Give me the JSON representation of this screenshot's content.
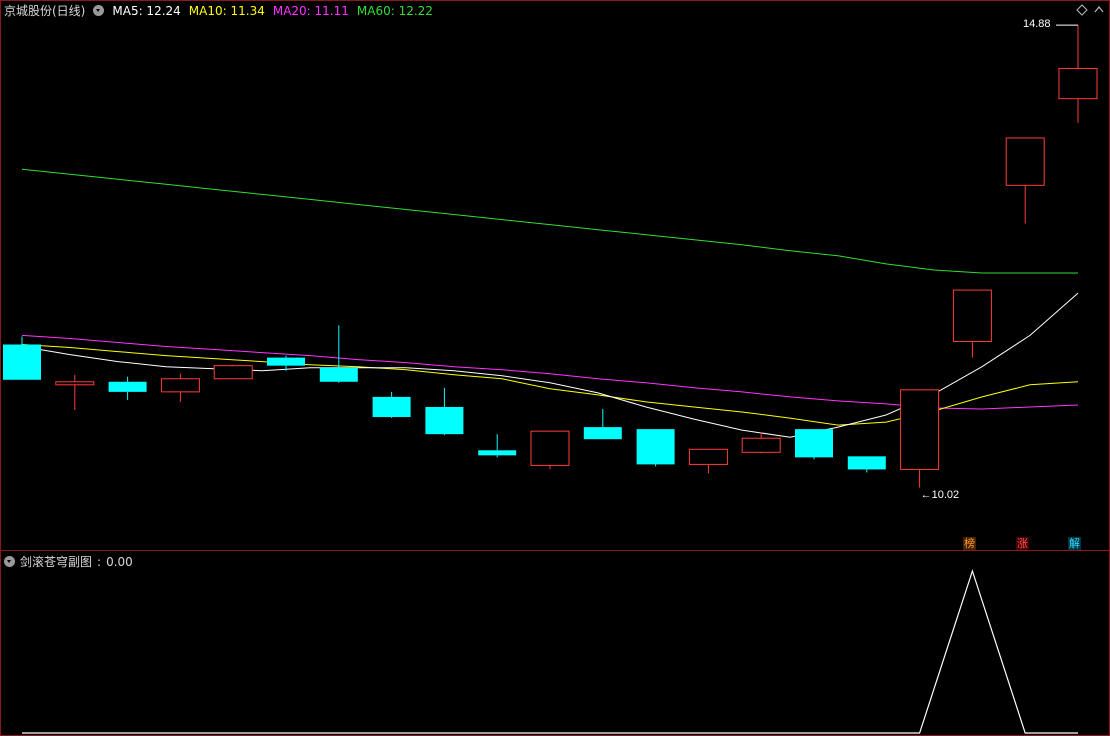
{
  "main_panel": {
    "title": "京城股份(日线)",
    "indicators": [
      {
        "label": "MA5: 12.24",
        "color": "#ffffff"
      },
      {
        "label": "MA10: 11.34",
        "color": "#ffff00"
      },
      {
        "label": "MA20: 11.11",
        "color": "#ff33ff"
      },
      {
        "label": "MA60: 12.22",
        "color": "#33dd33"
      }
    ],
    "high_label": "14.88",
    "low_label": "10.02",
    "badges": [
      {
        "text": "榜",
        "color": "#ff9933",
        "bg": "#442200"
      },
      {
        "text": "涨",
        "color": "#ff5555",
        "bg": "#440000"
      },
      {
        "text": "解",
        "color": "#33ddff",
        "bg": "#003344"
      }
    ]
  },
  "sub_panel": {
    "title": "剑滚苍穹副图",
    "value": "0.00"
  },
  "colors": {
    "up_candle": "#ff3b3b",
    "down_candle": "#00ffff",
    "ma5": "#ffffff",
    "ma10": "#ffff00",
    "ma20": "#ff33ff",
    "ma60": "#33dd33",
    "border": "#8a1a1a",
    "subline": "#ffffff"
  },
  "chart_data": {
    "type": "candlestick",
    "ylim": [
      9.72,
      15.05
    ],
    "candles": [
      {
        "o": 11.71,
        "h": 11.79,
        "l": 11.36,
        "c": 11.36
      },
      {
        "o": 11.31,
        "h": 11.41,
        "l": 11.06,
        "c": 11.34
      },
      {
        "o": 11.34,
        "h": 11.39,
        "l": 11.16,
        "c": 11.24
      },
      {
        "o": 11.24,
        "h": 11.42,
        "l": 11.14,
        "c": 11.37
      },
      {
        "o": 11.37,
        "h": 11.51,
        "l": 11.37,
        "c": 11.5
      },
      {
        "o": 11.58,
        "h": 11.6,
        "l": 11.45,
        "c": 11.5
      },
      {
        "o": 11.48,
        "h": 11.9,
        "l": 11.33,
        "c": 11.34
      },
      {
        "o": 11.19,
        "h": 11.24,
        "l": 10.98,
        "c": 10.99
      },
      {
        "o": 11.09,
        "h": 11.28,
        "l": 10.81,
        "c": 10.82
      },
      {
        "o": 10.66,
        "h": 10.82,
        "l": 10.59,
        "c": 10.61
      },
      {
        "o": 10.51,
        "h": 10.85,
        "l": 10.47,
        "c": 10.85
      },
      {
        "o": 10.89,
        "h": 11.07,
        "l": 10.77,
        "c": 10.77
      },
      {
        "o": 10.87,
        "h": 10.87,
        "l": 10.5,
        "c": 10.52
      },
      {
        "o": 10.52,
        "h": 10.67,
        "l": 10.43,
        "c": 10.67
      },
      {
        "o": 10.64,
        "h": 10.84,
        "l": 10.63,
        "c": 10.78
      },
      {
        "o": 10.87,
        "h": 10.87,
        "l": 10.57,
        "c": 10.59
      },
      {
        "o": 10.6,
        "h": 10.6,
        "l": 10.44,
        "c": 10.47
      },
      {
        "o": 10.47,
        "h": 11.26,
        "l": 10.29,
        "c": 11.26
      },
      {
        "o": 11.74,
        "h": 12.25,
        "l": 11.58,
        "c": 12.25
      },
      {
        "o": 13.29,
        "h": 13.76,
        "l": 12.91,
        "c": 13.76
      },
      {
        "o": 14.15,
        "h": 14.88,
        "l": 13.91,
        "c": 14.45
      }
    ],
    "ma5": [
      11.69,
      11.61,
      11.54,
      11.49,
      11.47,
      11.45,
      11.48,
      11.48,
      11.48,
      11.45,
      11.4,
      11.33,
      11.23,
      11.09,
      10.97,
      10.86,
      10.79,
      10.89,
      11.01,
      11.22,
      11.49,
      11.8,
      12.22
    ],
    "ma10": [
      11.71,
      11.68,
      11.64,
      11.6,
      11.57,
      11.54,
      11.51,
      11.49,
      11.46,
      11.41,
      11.37,
      11.27,
      11.21,
      11.14,
      11.09,
      11.04,
      10.98,
      10.91,
      10.94,
      11.05,
      11.19,
      11.31,
      11.34
    ],
    "ma20": [
      11.8,
      11.77,
      11.73,
      11.69,
      11.66,
      11.63,
      11.6,
      11.56,
      11.53,
      11.49,
      11.46,
      11.42,
      11.37,
      11.33,
      11.28,
      11.24,
      11.19,
      11.15,
      11.12,
      11.08,
      11.07,
      11.09,
      11.11
    ],
    "ma60": [
      13.45,
      13.4,
      13.35,
      13.3,
      13.25,
      13.2,
      13.15,
      13.1,
      13.05,
      13.0,
      12.95,
      12.9,
      12.85,
      12.8,
      12.75,
      12.7,
      12.64,
      12.59,
      12.51,
      12.45,
      12.42,
      12.42,
      12.42
    ],
    "sub_series": [
      0,
      0,
      0,
      0,
      0,
      0,
      0,
      0,
      0,
      0,
      0,
      0,
      0,
      0,
      0,
      0,
      0,
      0,
      1,
      0,
      0
    ]
  }
}
